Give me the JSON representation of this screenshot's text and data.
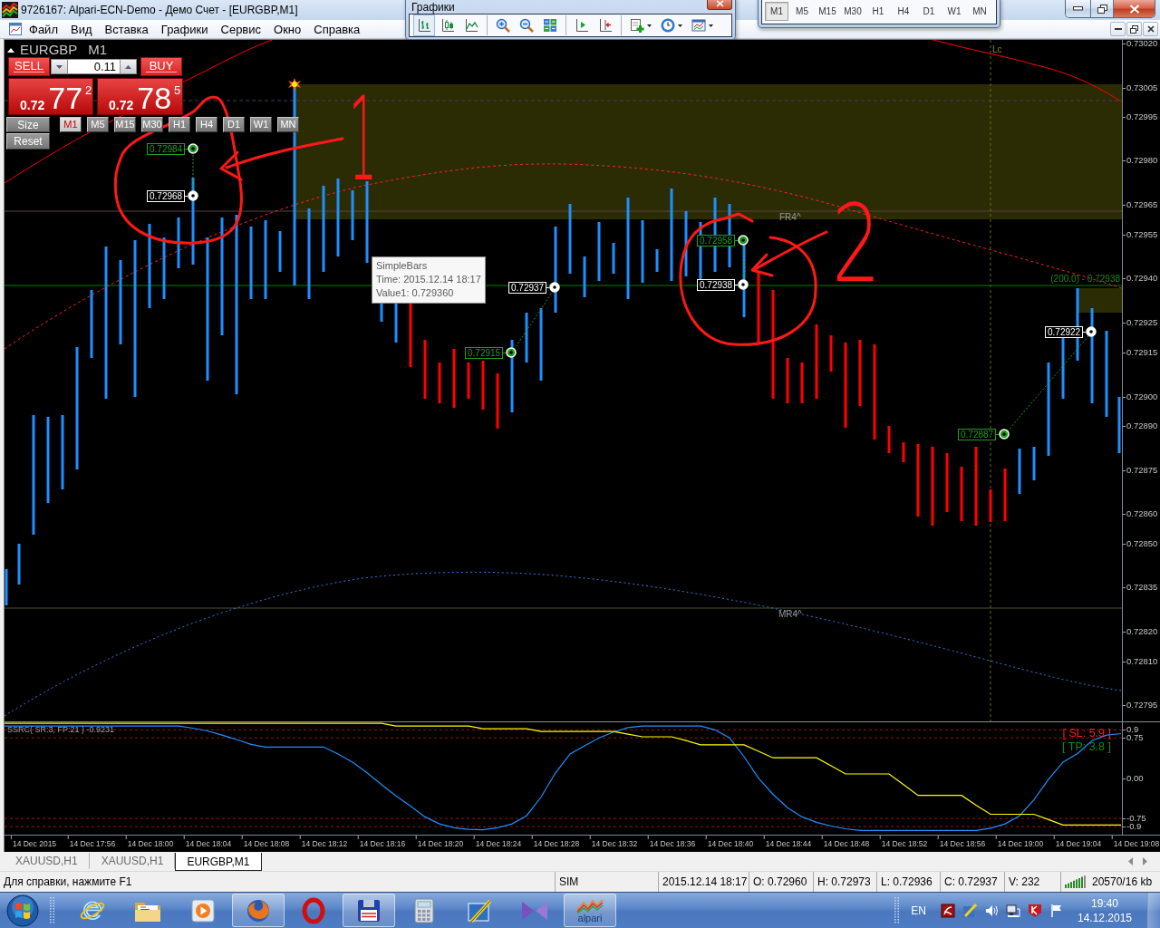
{
  "window": {
    "title": "9726167: Alpari-ECN-Demo - Демо Счет - [EURGBP,M1]"
  },
  "menu": [
    "Файл",
    "Вид",
    "Вставка",
    "Графики",
    "Сервис",
    "Окно",
    "Справка"
  ],
  "charts_toolbar": {
    "title": "Графики"
  },
  "periods_toolbar": [
    {
      "label": "M1",
      "selected": true
    },
    {
      "label": "M5",
      "selected": false
    },
    {
      "label": "M15",
      "selected": false
    },
    {
      "label": "M30",
      "selected": false
    },
    {
      "label": "H1",
      "selected": false
    },
    {
      "label": "H4",
      "selected": false
    },
    {
      "label": "D1",
      "selected": false
    },
    {
      "label": "W1",
      "selected": false
    },
    {
      "label": "MN",
      "selected": false
    }
  ],
  "chart": {
    "symbol": "EURGBP",
    "period": "M1",
    "trade_panel": {
      "sell": "SELL",
      "buy": "BUY",
      "lots": "0.11",
      "bid": {
        "head": "0.72",
        "big": "77",
        "tail": "2"
      },
      "ask": {
        "head": "0.72",
        "big": "78",
        "tail": "5"
      },
      "size": "Size",
      "reset": "Reset",
      "periods": [
        {
          "label": "M1",
          "selected": true
        },
        {
          "label": "M5",
          "selected": false
        },
        {
          "label": "M15",
          "selected": false
        },
        {
          "label": "M30",
          "selected": false
        },
        {
          "label": "H1",
          "selected": false
        },
        {
          "label": "H4",
          "selected": false
        },
        {
          "label": "D1",
          "selected": false
        },
        {
          "label": "W1",
          "selected": false
        },
        {
          "label": "MN",
          "selected": false
        }
      ]
    },
    "price_axis": [
      "0.73020",
      "0.73005",
      "0.72995",
      "0.72980",
      "0.72965",
      "0.72955",
      "0.72940",
      "0.72925",
      "0.72915",
      "0.72900",
      "0.72890",
      "0.72875",
      "0.72860",
      "0.72850",
      "0.72835",
      "0.72820",
      "0.72810",
      "0.72795"
    ],
    "markers": [
      {
        "price": "0.72984",
        "color": "#1e9e1e"
      },
      {
        "price": "0.72968",
        "color": "#ffffff"
      },
      {
        "price": "0.72937",
        "color": "#ffffff"
      },
      {
        "price": "0.72915",
        "color": "#1e9e1e"
      },
      {
        "price": "0.72958",
        "color": "#1e9e1e"
      },
      {
        "price": "0.72938",
        "color": "#ffffff"
      },
      {
        "price": "0.72922",
        "color": "#ffffff"
      },
      {
        "price": "0.72887",
        "color": "#1e9e1e"
      }
    ],
    "line_labels": [
      "Lc",
      "FR4^",
      "MR4^",
      "(200.0) - 0.72938"
    ],
    "tooltip": {
      "title": "SimpleBars",
      "lines": [
        "Time: 2015.12.14 18:17",
        "Value1: 0.729360"
      ]
    },
    "handwritten": [
      "1",
      "2"
    ]
  },
  "indicator": {
    "stop_loss": "[ SL: 5.9 ]",
    "take_profit": "[ TP: 3.8 ]",
    "chart_data": {
      "type": "line",
      "title": "SSRC( SR:3, FP:21 ) -0.9231",
      "grid": true,
      "categories": [
        null,
        null,
        "14 Dec 2015",
        null,
        null,
        null,
        "14 Dec 17:56",
        null,
        null,
        null,
        "14 Dec 18:00",
        null,
        null,
        null,
        "14 Dec 18:04",
        null,
        null,
        null,
        "14 Dec 18:08",
        null,
        null,
        null,
        "14 Dec 18:12",
        null,
        null,
        null,
        "14 Dec 18:16",
        null,
        null,
        null,
        "14 Dec 18:20",
        null,
        null,
        null,
        "14 Dec 18:24",
        null,
        null,
        null,
        "14 Dec 18:28",
        null,
        null,
        null,
        "14 Dec 18:32",
        null,
        null,
        null,
        "14 Dec 18:36",
        null,
        null,
        null,
        "14 Dec 18:40",
        null,
        null,
        null,
        "14 Dec 18:44",
        null,
        null,
        null,
        "14 Dec 18:48",
        null,
        null,
        null,
        "14 Dec 18:52",
        null,
        null,
        null,
        "14 Dec 18:56",
        null,
        null,
        null,
        "14 Dec 19:00",
        null,
        null,
        null,
        "14 Dec 19:04",
        null,
        null,
        null,
        "14 Dec 19:08"
      ],
      "series": [
        {
          "color": "#1e90ff",
          "values": [
            0.97,
            0.97,
            0.97,
            0.97,
            0.97,
            0.97,
            0.97,
            0.97,
            0.97,
            0.97,
            0.97,
            0.97,
            0.97,
            0.93,
            0.88,
            0.8,
            0.72,
            0.63,
            0.58,
            0.58,
            0.58,
            0.58,
            0.58,
            0.45,
            0.3,
            0.1,
            -0.12,
            -0.33,
            -0.52,
            -0.72,
            -0.85,
            -0.92,
            -0.95,
            -0.96,
            -0.92,
            -0.85,
            -0.7,
            -0.35,
            0.1,
            0.45,
            0.6,
            0.75,
            0.86,
            0.94,
            0.97,
            0.97,
            0.97,
            0.97,
            0.97,
            0.9,
            0.75,
            0.4,
            0.0,
            -0.3,
            -0.55,
            -0.72,
            -0.82,
            -0.89,
            -0.94,
            -0.97,
            -0.97,
            -0.97,
            -0.97,
            -0.97,
            -0.97,
            -0.97,
            -0.97,
            -0.97,
            -0.93,
            -0.85,
            -0.7,
            -0.4,
            -0.02,
            0.3,
            0.46,
            0.7,
            0.8,
            0.83,
            null
          ]
        },
        {
          "color": "#ffff00",
          "values": [
            1.02,
            1.02,
            1.02,
            1.02,
            1.02,
            1.02,
            1.02,
            1.02,
            1.02,
            1.02,
            1.02,
            1.02,
            1.02,
            1.02,
            1.02,
            1.02,
            1.02,
            1.02,
            1.02,
            1.02,
            1.02,
            1.02,
            1.02,
            1.02,
            1.02,
            1.02,
            1.02,
            0.97,
            0.97,
            0.97,
            0.97,
            0.97,
            0.97,
            0.92,
            0.92,
            0.92,
            0.92,
            0.87,
            0.87,
            0.87,
            0.87,
            0.87,
            0.87,
            0.82,
            0.77,
            0.77,
            0.77,
            0.7,
            0.62,
            0.62,
            0.62,
            0.62,
            0.5,
            0.38,
            0.38,
            0.38,
            0.38,
            0.23,
            0.08,
            0.08,
            0.08,
            0.08,
            -0.12,
            -0.32,
            -0.32,
            -0.32,
            -0.32,
            -0.5,
            -0.67,
            -0.67,
            -0.67,
            -0.67,
            -0.77,
            -0.87,
            -0.87,
            -0.87,
            -0.87,
            -0.87,
            null
          ]
        }
      ],
      "ylim": [
        -1.05,
        1.04
      ],
      "yticks": [
        {
          "value": 0.9,
          "label": "0.9"
        },
        {
          "value": 0.75,
          "label": "0.75"
        },
        {
          "value": 0,
          "label": "0.00"
        },
        {
          "value": -0.75,
          "label": "-0.75"
        },
        {
          "value": -0.9,
          "label": "-0.9"
        }
      ]
    }
  },
  "tabs": [
    {
      "label": "XAUUSD,H1",
      "selected": false
    },
    {
      "label": "XAUUSD,H1",
      "selected": false
    },
    {
      "label": "EURGBP,M1",
      "selected": true
    }
  ],
  "status_bar": {
    "help": "Для справки, нажмите F1",
    "mode": "SIM",
    "time": "2015.12.14 18:17",
    "open": "O: 0.72960",
    "high": "H: 0.72973",
    "low": "L: 0.72936",
    "close": "C: 0.72937",
    "volume": "V: 232",
    "traffic": "20570/16 kb"
  },
  "taskbar": {
    "apps": [
      {
        "kind": "ie",
        "open": false
      },
      {
        "kind": "folder",
        "open": false
      },
      {
        "kind": "player",
        "open": false
      },
      {
        "kind": "firefox",
        "open": true
      },
      {
        "kind": "opera",
        "open": false
      },
      {
        "kind": "floppy",
        "open": true
      },
      {
        "kind": "calculator",
        "open": false
      },
      {
        "kind": "paint",
        "open": false
      },
      {
        "kind": "studio",
        "open": false
      },
      {
        "kind": "alpari",
        "open": true,
        "label": "alpari"
      }
    ],
    "language": "EN",
    "time": "19:40",
    "date": "14.12.2015"
  }
}
